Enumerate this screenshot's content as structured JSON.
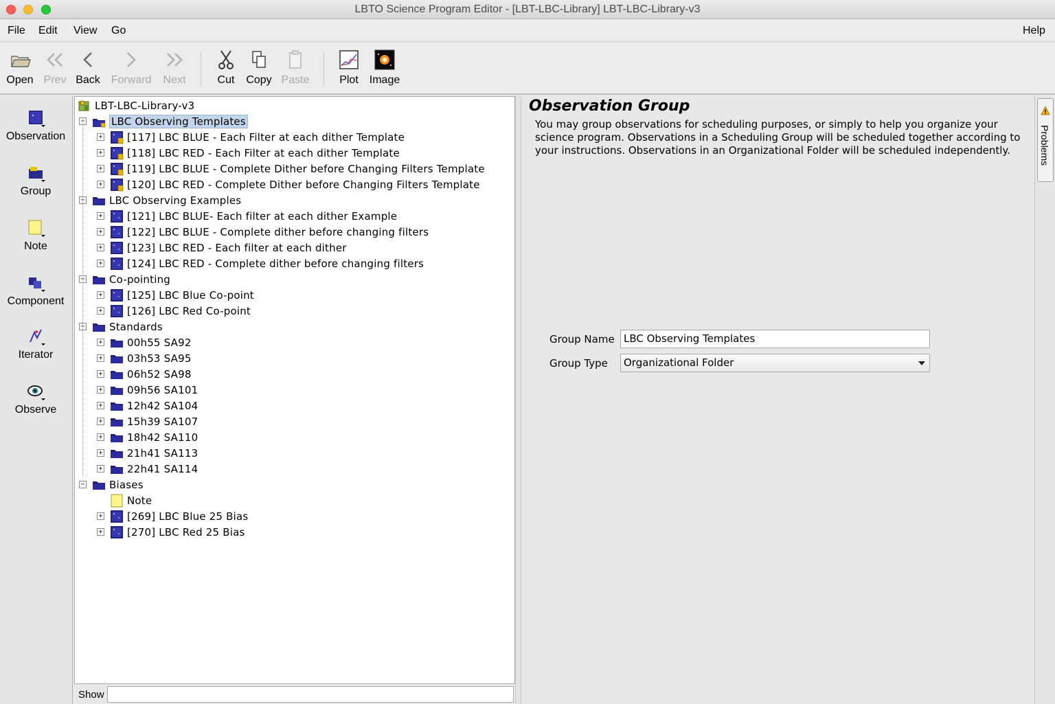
{
  "window": {
    "title": "LBTO Science Program Editor - [LBT-LBC-Library] LBT-LBC-Library-v3"
  },
  "menubar": {
    "items": [
      "File",
      "Edit",
      "View",
      "Go"
    ],
    "help": "Help"
  },
  "toolbar": {
    "open": "Open",
    "prev": "Prev",
    "back": "Back",
    "forward": "Forward",
    "next": "Next",
    "cut": "Cut",
    "copy": "Copy",
    "paste": "Paste",
    "plot": "Plot",
    "image": "Image"
  },
  "palette": {
    "observation": "Observation",
    "group": "Group",
    "note": "Note",
    "component": "Component",
    "iterator": "Iterator",
    "observe": "Observe"
  },
  "tree": {
    "root": "LBT-LBC-Library-v3",
    "templates": {
      "label": "LBC Observing Templates",
      "items": [
        "[117] LBC BLUE - Each Filter at each dither Template",
        "[118] LBC RED - Each Filter at each dither Template",
        "[119] LBC BLUE - Complete Dither before Changing Filters Template",
        "[120] LBC RED - Complete Dither before Changing Filters Template"
      ]
    },
    "examples": {
      "label": "LBC Observing Examples",
      "items": [
        "[121] LBC BLUE- Each filter at each dither Example",
        "[122] LBC BLUE - Complete dither before changing filters",
        "[123] LBC RED - Each filter at each dither",
        "[124] LBC RED - Complete dither before changing filters"
      ]
    },
    "copointing": {
      "label": "Co-pointing",
      "items": [
        "[125] LBC Blue Co-point",
        "[126] LBC Red Co-point"
      ]
    },
    "standards": {
      "label": "Standards",
      "items": [
        "00h55 SA92",
        "03h53 SA95",
        "06h52 SA98",
        "09h56 SA101",
        "12h42 SA104",
        "15h39 SA107",
        "18h42 SA110",
        "21h41 SA113",
        "22h41 SA114"
      ]
    },
    "biases": {
      "label": "Biases",
      "note": "Note",
      "items": [
        "[269] LBC Blue 25 Bias",
        "[270] LBC Red 25 Bias"
      ]
    }
  },
  "show": {
    "label": "Show",
    "value": ""
  },
  "detail": {
    "title": "Observation Group",
    "description": "You may group observations for scheduling purposes, or simply to help you organize your science program. Observations in a Scheduling Group will be scheduled together according to your instructions. Observations in an Organizational Folder will be scheduled independently.",
    "group_name_label": "Group Name",
    "group_name_value": "LBC Observing Templates",
    "group_type_label": "Group Type",
    "group_type_value": "Organizational Folder"
  },
  "sidebar": {
    "problems": "Problems"
  }
}
